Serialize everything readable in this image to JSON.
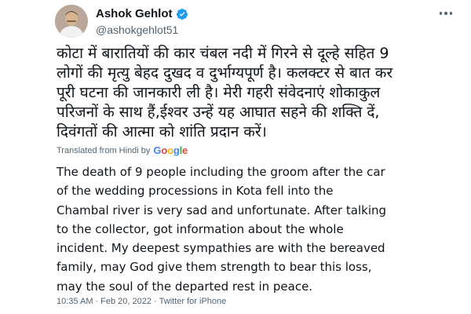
{
  "author": {
    "display_name": "Ashok Gehlot",
    "handle": "@ashokgehlot51",
    "verified": true
  },
  "icons": {
    "verified": "verified-badge-icon",
    "more": "more-options-icon",
    "avatar": "profile-avatar"
  },
  "colors": {
    "verified_blue": "#1d9bf0",
    "secondary_text": "#536471",
    "primary_text": "#0f1419"
  },
  "tweet": {
    "original_lines": [
      "कोटा में बारातियों की कार चंबल नदी में गिरने से दूल्हे सहित 9",
      "लोगों की मृत्यु बेहद दुखद व दुर्भाग्यपूर्ण है। कलक्टर से बात कर",
      "पूरी घटना की जानकारी ली है। मेरी गहरी संवेदनाएं शोकाकुल",
      "परिजनों के साथ हैं,ईश्वर उन्हें यह आघात सहने की शक्ति दें,",
      "दिवंगतों की आत्मा को शांति प्रदान करें।"
    ],
    "translated_label": "Translated from Hindi by",
    "translator": "Google",
    "translation_lines": [
      "The death of 9 people including the groom after the car",
      "of the wedding processions in Kota fell into the",
      "Chambal river is very sad and unfortunate. After talking",
      "to the collector, got information about the whole",
      "incident. My deepest sympathies are with the bereaved",
      "family, may God give them strength to bear this loss,",
      "may the soul of the departed rest in peace."
    ]
  },
  "meta": {
    "time": "10:35 AM",
    "separator": "·",
    "date": "Feb 20, 2022",
    "source": "Twitter for iPhone"
  }
}
